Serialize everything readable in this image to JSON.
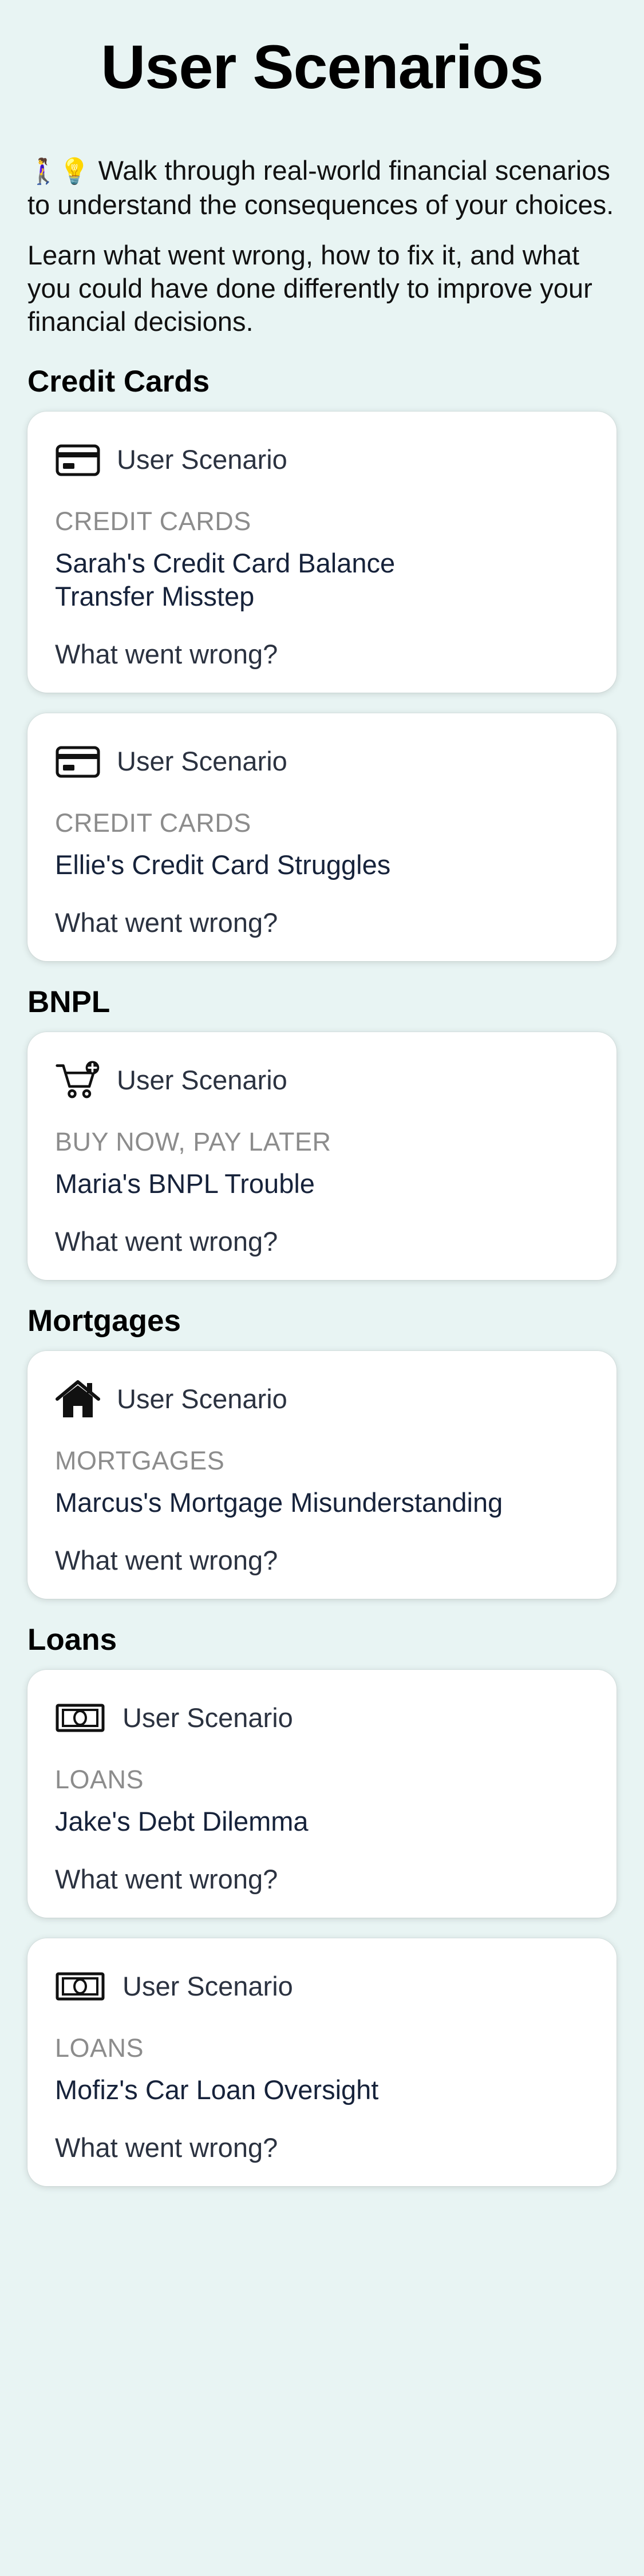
{
  "page": {
    "title": "User Scenarios",
    "intro": {
      "emoji": "🚶‍♀️💡",
      "line1": "Walk through real-world financial scenarios to understand the consequences of your choices.",
      "line2": "Learn what went wrong, how to fix it, and what you could have done differently to improve your financial decisions."
    }
  },
  "sections": [
    {
      "title": "Credit Cards",
      "cards": [
        {
          "icon": "credit-card-icon",
          "header": "User Scenario",
          "category": "CREDIT CARDS",
          "title": "Sarah's Credit Card Balance Transfer Misstep",
          "link": "What went wrong?"
        },
        {
          "icon": "credit-card-icon",
          "header": "User Scenario",
          "category": "CREDIT CARDS",
          "title": "Ellie's Credit Card Struggles",
          "link": "What went wrong?"
        }
      ]
    },
    {
      "title": "BNPL",
      "cards": [
        {
          "icon": "cart-plus-icon",
          "header": "User Scenario",
          "category": "BUY NOW, PAY LATER",
          "title": "Maria's BNPL Trouble",
          "link": "What went wrong?"
        }
      ]
    },
    {
      "title": "Mortgages",
      "cards": [
        {
          "icon": "house-icon",
          "header": "User Scenario",
          "category": "MORTGAGES",
          "title": "Marcus's Mortgage Misunderstanding",
          "link": "What went wrong?"
        }
      ]
    },
    {
      "title": "Loans",
      "cards": [
        {
          "icon": "banknote-icon",
          "header": "User Scenario",
          "category": "LOANS",
          "title": "Jake's Debt Dilemma",
          "link": "What went wrong?"
        },
        {
          "icon": "banknote-icon",
          "header": "User Scenario",
          "category": "LOANS",
          "title": "Mofiz's Car Loan Oversight",
          "link": "What went wrong?"
        }
      ]
    }
  ],
  "colors": {
    "background": "#e8f4f3",
    "card": "#ffffff",
    "category_text": "#8c8c8c",
    "title_text": "#16223a"
  }
}
